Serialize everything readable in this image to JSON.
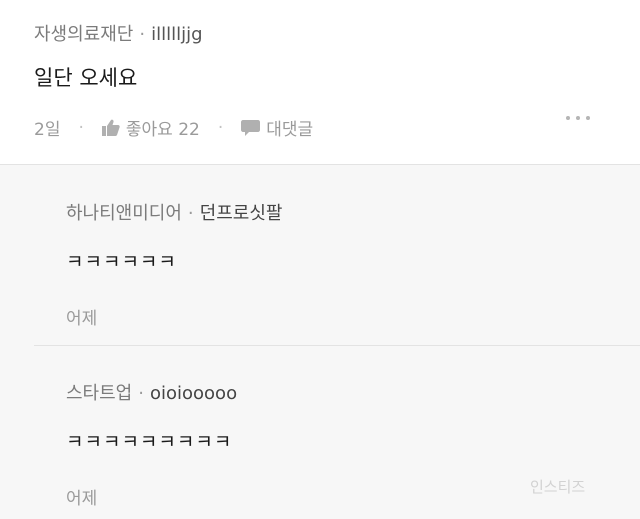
{
  "post": {
    "community": "자생의료재단",
    "author": "illllljjg",
    "text": "일단 오세요",
    "time": "2일",
    "like_label": "좋아요 22",
    "reply_label": "대댓글",
    "icons": {
      "like": "thumbs-up-icon",
      "reply": "speech-bubble-icon",
      "more": "more-dots-icon"
    }
  },
  "comments": [
    {
      "community": "하나티앤미디어",
      "author": "던프로싯팔",
      "text": "ㅋㅋㅋㅋㅋㅋ",
      "time": "어제"
    },
    {
      "community": "스타트업",
      "author": "oioiooooo",
      "text": "ㅋㅋㅋㅋㅋㅋㅋㅋㅋ",
      "time": "어제"
    }
  ],
  "watermark": "인스티즈",
  "colors": {
    "muted": "#9a9a9a",
    "text": "#1a1a1a",
    "comment_bg": "#f7f7f7"
  }
}
